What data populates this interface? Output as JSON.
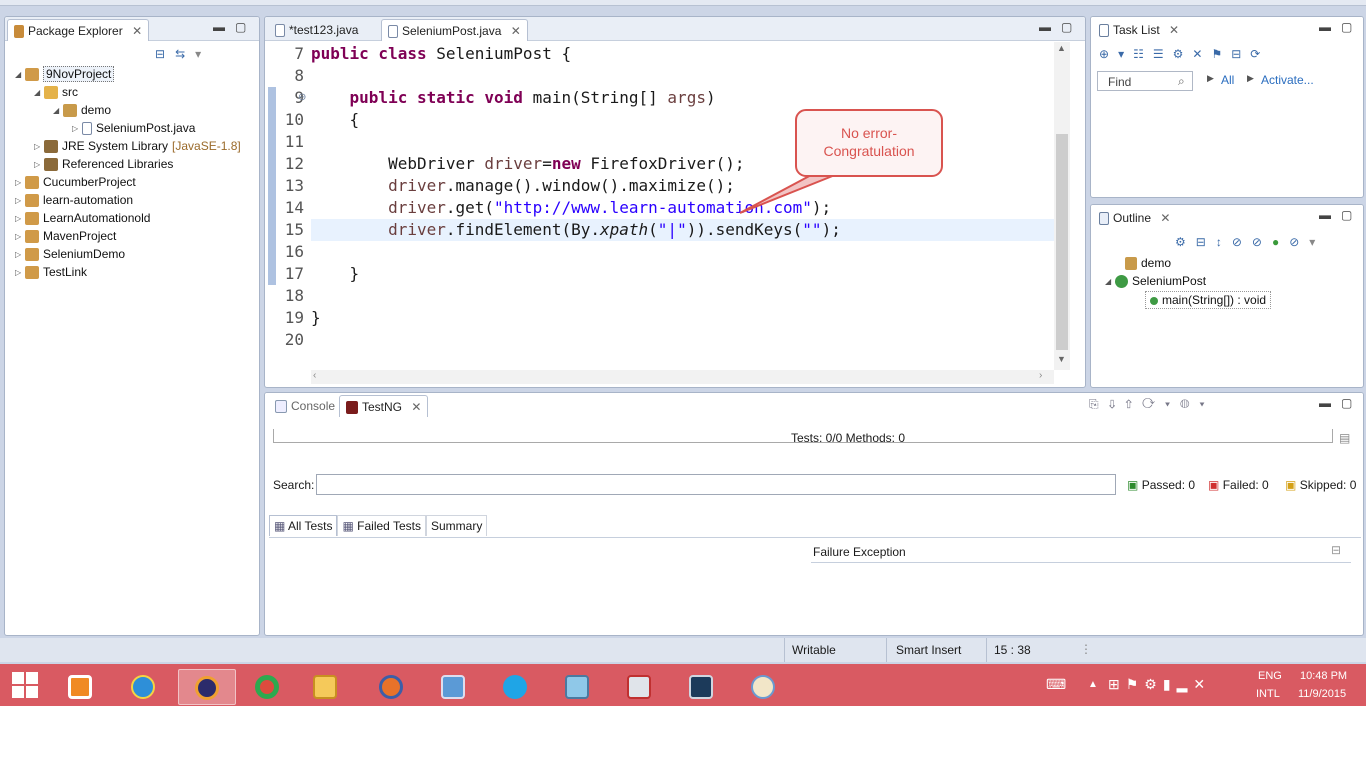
{
  "package_explorer": {
    "tab_label": "Package Explorer",
    "items": [
      {
        "label": "9NovProject",
        "depth": 0,
        "expanded": true,
        "selected": true
      },
      {
        "label": "src",
        "depth": 1,
        "expanded": true
      },
      {
        "label": "demo",
        "depth": 2,
        "expanded": true
      },
      {
        "label": "SeleniumPost.java",
        "depth": 3,
        "expanded": false
      },
      {
        "label": "JRE System Library",
        "suffix": "[JavaSE-1.8]",
        "depth": 1,
        "expanded": false
      },
      {
        "label": "Referenced Libraries",
        "depth": 1,
        "expanded": false
      },
      {
        "label": "CucumberProject",
        "depth": 0,
        "expanded": false
      },
      {
        "label": "learn-automation",
        "depth": 0,
        "expanded": false
      },
      {
        "label": "LearnAutomationold",
        "depth": 0,
        "expanded": false
      },
      {
        "label": "MavenProject",
        "depth": 0,
        "expanded": false
      },
      {
        "label": "SeleniumDemo",
        "depth": 0,
        "expanded": false
      },
      {
        "label": "TestLink",
        "depth": 0,
        "expanded": false
      }
    ]
  },
  "editor": {
    "tabs": [
      {
        "label": "*test123.java",
        "active": false
      },
      {
        "label": "SeleniumPost.java",
        "active": true
      }
    ],
    "lines": [
      {
        "n": "7",
        "segments": [
          {
            "t": "public class ",
            "c": "kw"
          },
          {
            "t": "SeleniumPost {",
            "c": ""
          }
        ]
      },
      {
        "n": "8",
        "segments": []
      },
      {
        "n": "9",
        "fold": "⊖",
        "segments": [
          {
            "t": "    ",
            "c": ""
          },
          {
            "t": "public static void ",
            "c": "kw"
          },
          {
            "t": "main(String[] ",
            "c": ""
          },
          {
            "t": "args",
            "c": "var"
          },
          {
            "t": ")",
            "c": ""
          }
        ]
      },
      {
        "n": "10",
        "segments": [
          {
            "t": "    {",
            "c": ""
          }
        ]
      },
      {
        "n": "11",
        "segments": []
      },
      {
        "n": "12",
        "segments": [
          {
            "t": "        WebDriver ",
            "c": ""
          },
          {
            "t": "driver",
            "c": "var"
          },
          {
            "t": "=",
            "c": ""
          },
          {
            "t": "new ",
            "c": "kw"
          },
          {
            "t": "FirefoxDriver();",
            "c": ""
          }
        ]
      },
      {
        "n": "13",
        "segments": [
          {
            "t": "        ",
            "c": ""
          },
          {
            "t": "driver",
            "c": "var"
          },
          {
            "t": ".manage().window().maximize();",
            "c": ""
          }
        ]
      },
      {
        "n": "14",
        "segments": [
          {
            "t": "        ",
            "c": ""
          },
          {
            "t": "driver",
            "c": "var"
          },
          {
            "t": ".get(",
            "c": ""
          },
          {
            "t": "\"http://www.learn-automation.com\"",
            "c": "str"
          },
          {
            "t": ");",
            "c": ""
          }
        ]
      },
      {
        "n": "15",
        "current": true,
        "segments": [
          {
            "t": "        ",
            "c": ""
          },
          {
            "t": "driver",
            "c": "var"
          },
          {
            "t": ".findElement(By.",
            "c": ""
          },
          {
            "t": "xpath",
            "c": "ital"
          },
          {
            "t": "(",
            "c": ""
          },
          {
            "t": "\"|\"",
            "c": "str"
          },
          {
            "t": ")).sendKeys(",
            "c": ""
          },
          {
            "t": "\"\"",
            "c": "str"
          },
          {
            "t": ");",
            "c": ""
          }
        ]
      },
      {
        "n": "16",
        "segments": []
      },
      {
        "n": "17",
        "segments": [
          {
            "t": "    }",
            "c": ""
          }
        ]
      },
      {
        "n": "18",
        "segments": []
      },
      {
        "n": "19",
        "segments": [
          {
            "t": "}",
            "c": ""
          }
        ]
      },
      {
        "n": "20",
        "segments": []
      }
    ],
    "callout": "No error-\nCongratulation"
  },
  "task_list": {
    "tab_label": "Task List",
    "find_placeholder": "Find",
    "all_label": "All",
    "activate_label": "Activate..."
  },
  "outline": {
    "tab_label": "Outline",
    "items": [
      {
        "label": "demo"
      },
      {
        "label": "SeleniumPost"
      },
      {
        "label": "main(String[]) : void"
      }
    ]
  },
  "bottom": {
    "console_tab": "Console",
    "testng_tab": "TestNG",
    "summary": "Tests: 0/0  Methods: 0",
    "search_label": "Search:",
    "passed": "Passed: 0",
    "failed": "Failed: 0",
    "skipped": "Skipped: 0",
    "subtabs": [
      "All Tests",
      "Failed Tests",
      "Summary"
    ],
    "failure_header": "Failure Exception"
  },
  "statusbar": {
    "writable": "Writable",
    "insert": "Smart Insert",
    "position": "15 : 38"
  },
  "taskbar": {
    "lang1": "ENG",
    "lang2": "INTL",
    "time": "10:48 PM",
    "date": "11/9/2015"
  }
}
